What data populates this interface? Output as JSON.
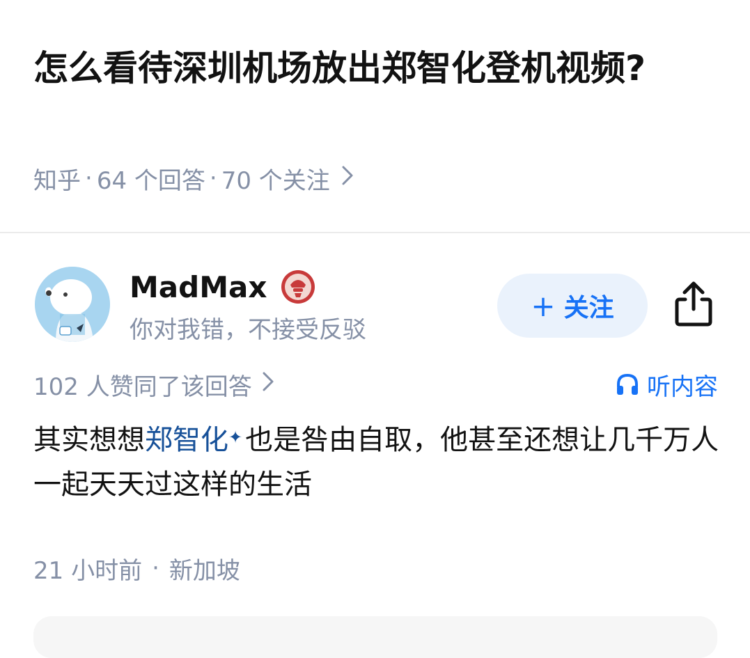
{
  "question": {
    "title": "怎么看待深圳机场放出郑智化登机视频?",
    "source": "知乎",
    "answers_count": "64 个回答",
    "followers_count": "70 个关注",
    "separator": "·"
  },
  "author": {
    "name": "MadMax",
    "bio": "你对我错，不接受反驳",
    "follow_label": "关注",
    "follow_plus": "+"
  },
  "answer": {
    "upvote_text": "102 人赞同了该回答",
    "listen_label": "听内容",
    "text_before": "其实想想",
    "keyword": "郑智化",
    "keyword_mark": "✦",
    "text_after": "也是咎由自取，他甚至还想让几千万人一起天天过这样的生活",
    "time": "21 小时前",
    "location": "新加坡",
    "separator": "·"
  },
  "icons": {
    "share": "share-icon",
    "headphones": "headphones-icon",
    "chevron": "chevron-right-icon",
    "badge": "badge-icon"
  },
  "colors": {
    "primary": "#1772f6",
    "keyword": "#175199",
    "muted": "#8590a6",
    "text": "#121212",
    "follow_bg": "#eaf2fc",
    "badge": "#c83a3a"
  }
}
